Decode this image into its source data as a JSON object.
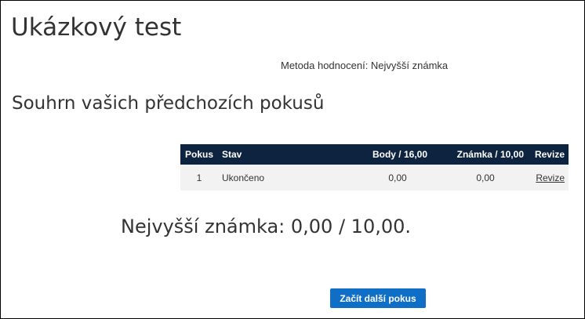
{
  "quiz": {
    "title": "Ukázkový test",
    "grading_method": "Metoda hodnocení: Nejvyšší známka"
  },
  "summary": {
    "heading": "Souhrn vašich předchozích pokusů",
    "table": {
      "headers": {
        "attempt": "Pokus",
        "state": "Stav",
        "marks": "Body / 16,00",
        "grade": "Známka / 10,00",
        "review": "Revize"
      },
      "rows": [
        {
          "attempt": "1",
          "state": "Ukončeno",
          "marks": "0,00",
          "grade": "0,00",
          "review": "Revize"
        }
      ]
    }
  },
  "result": {
    "highest_grade": "Nejvyšší známka: 0,00 / 10,00."
  },
  "actions": {
    "start_button_label": "Začít další pokus"
  },
  "colors": {
    "table_header_bg": "#0e2340",
    "button_bg": "#0f6fc6",
    "row_bg": "#f2f2f2"
  }
}
